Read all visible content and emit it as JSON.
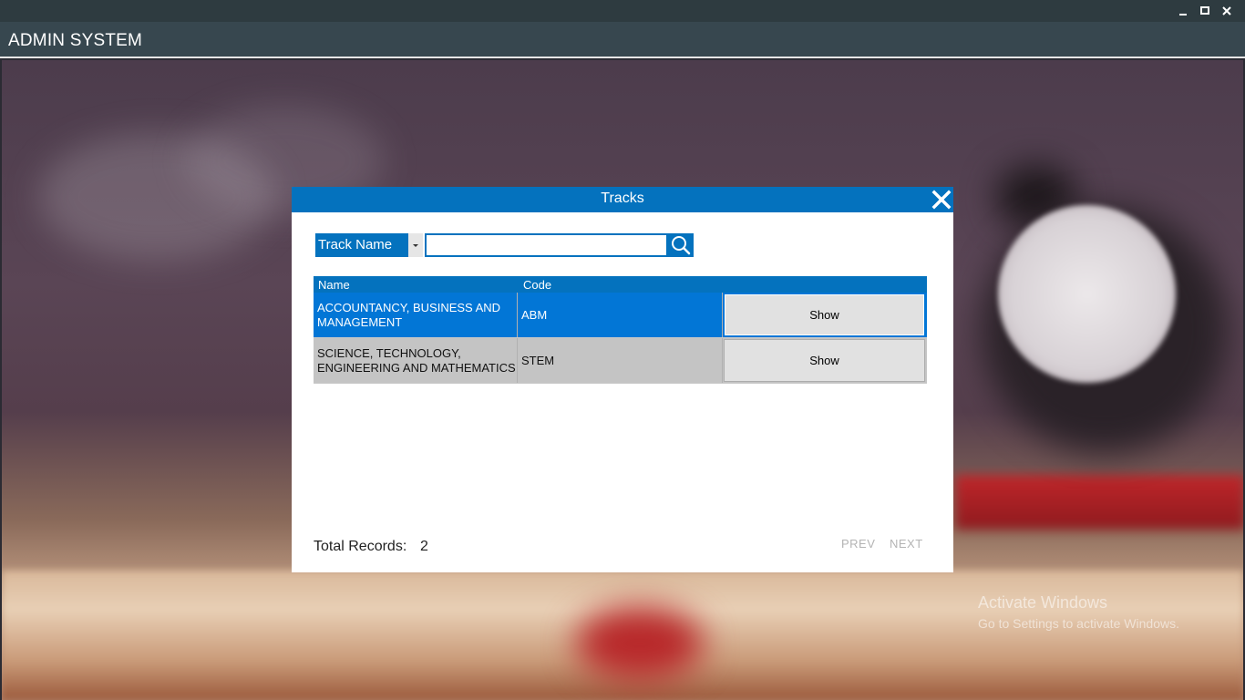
{
  "window": {
    "minimize_icon": "minimize-icon",
    "maximize_icon": "maximize-icon",
    "close_icon": "close-icon"
  },
  "app": {
    "title": "ADMIN SYSTEM"
  },
  "dialog": {
    "title": "Tracks",
    "close_icon": "close-x-icon",
    "accent_color": "#0472be"
  },
  "search": {
    "filter_selected": "Track Name",
    "value": "",
    "placeholder": "",
    "search_icon": "search-icon"
  },
  "table": {
    "columns": [
      "Name",
      "Code",
      ""
    ],
    "rows": [
      {
        "name": "ACCOUNTANCY, BUSINESS AND MANAGEMENT",
        "code": "ABM",
        "action": "Show",
        "selected": true
      },
      {
        "name": "SCIENCE, TECHNOLOGY, ENGINEERING AND MATHEMATICS",
        "code": "STEM",
        "action": "Show",
        "selected": false
      }
    ],
    "selected_color": "#0276d6"
  },
  "footer": {
    "total_label": "Total Records:",
    "total_value": "2",
    "prev_label": "PREV",
    "next_label": "NEXT"
  },
  "watermark": {
    "title": "Activate Windows",
    "subtitle": "Go to Settings to activate Windows."
  }
}
